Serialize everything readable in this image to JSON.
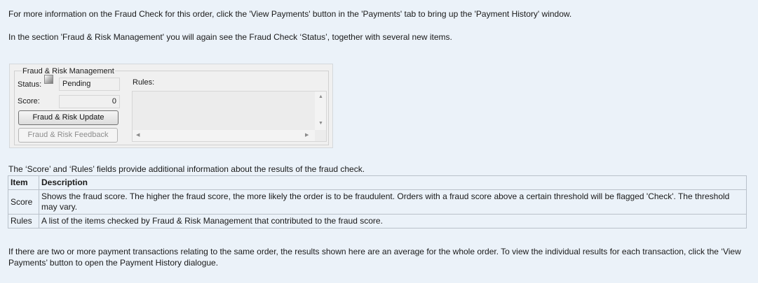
{
  "intro": {
    "paragraph1": "For more information on the Fraud Check for this order, click the 'View Payments' button in the 'Payments' tab to bring up the 'Payment History' window.",
    "paragraph2": "In the section 'Fraud & Risk Management' you will again see the Fraud Check ‘Status’, together with several new items."
  },
  "panel": {
    "group_title": "Fraud & Risk Management",
    "status_label": "Status:",
    "status_icon": "status-gray-icon",
    "status_value": "Pending",
    "score_label": "Score:",
    "score_value": "0",
    "rules_label": "Rules:",
    "update_button": "Fraud & Risk Update",
    "feedback_button": "Fraud & Risk Feedback"
  },
  "fields_intro": "The ‘Score’ and ‘Rules’ fields provide additional information about the results of the fraud check.",
  "table": {
    "headers": [
      "Item",
      "Description"
    ],
    "rows": [
      {
        "item": "Score",
        "description": "Shows the fraud score. The higher the fraud score, the more likely the order is to be fraudulent. Orders with a fraud score above a certain threshold will be flagged 'Check'. The threshold may vary."
      },
      {
        "item": "Rules",
        "description": "A list of the items checked by Fraud & Risk Management that contributed to the fraud score."
      }
    ]
  },
  "footer": "If there are two or more payment transactions relating to the same order, the results shown here are an average for the whole order. To view the individual results for each transaction, click the ‘View Payments’ button to open the Payment History dialogue."
}
